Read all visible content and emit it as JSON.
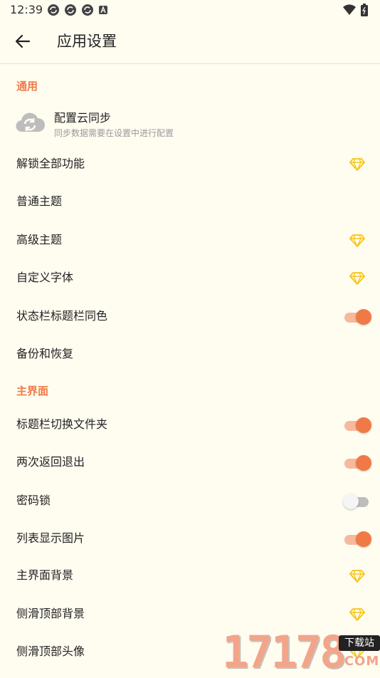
{
  "status_bar": {
    "time": "12:39",
    "left_icons": [
      "sync-notification-icon",
      "sync-notification-icon",
      "sync-notification-icon",
      "app-notification-icon"
    ],
    "right_icons": [
      "wifi-icon",
      "battery-icon"
    ]
  },
  "app_bar": {
    "title": "应用设置",
    "back_icon": "arrow-back-icon"
  },
  "accent_color": "#F07A45",
  "sections": {
    "general": "通用",
    "main_screen": "主界面"
  },
  "cloud_sync": {
    "title": "配置云同步",
    "subtitle": "同步数据需要在设置中进行配置",
    "icon": "cloud-sync-icon"
  },
  "rows": [
    {
      "label": "解锁全部功能",
      "trailing": "diamond"
    },
    {
      "label": "普通主题",
      "trailing": "none"
    },
    {
      "label": "高级主题",
      "trailing": "diamond"
    },
    {
      "label": "自定义字体",
      "trailing": "diamond"
    },
    {
      "label": "状态栏标题栏同色",
      "trailing": "toggle",
      "on": true
    },
    {
      "label": "备份和恢复",
      "trailing": "none"
    },
    {
      "label": "标题栏切换文件夹",
      "trailing": "toggle",
      "on": true
    },
    {
      "label": "两次返回退出",
      "trailing": "toggle",
      "on": true
    },
    {
      "label": "密码锁",
      "trailing": "toggle",
      "on": false
    },
    {
      "label": "列表显示图片",
      "trailing": "toggle",
      "on": true
    },
    {
      "label": "主界面背景",
      "trailing": "diamond"
    },
    {
      "label": "侧滑顶部背景",
      "trailing": "diamond"
    },
    {
      "label": "侧滑顶部头像",
      "trailing": "diamond"
    }
  ],
  "watermark": {
    "number": "17178",
    "badge": "下载站",
    "domain": ".COM"
  }
}
